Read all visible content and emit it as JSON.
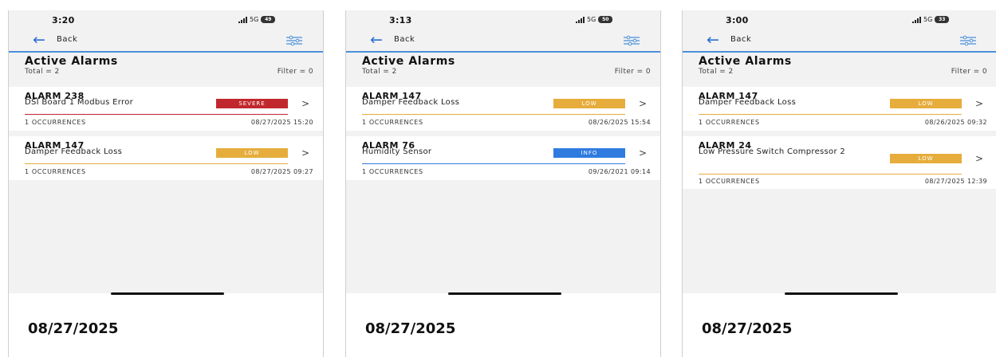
{
  "common": {
    "back_label": "Back",
    "title": "Active Alarms",
    "total": "Total = 2",
    "filter": "Filter = 0",
    "caption": "08/27/2025"
  },
  "colors": {
    "severe": "#c0282d",
    "low": "#e6ad3c",
    "info": "#2f7be0",
    "accent": "#4a8fdb"
  },
  "icons": {
    "back": "left-arrow-icon",
    "filter": "sliders-icon",
    "chevron": "chevron-right-icon"
  },
  "panels": [
    {
      "time": "3:20",
      "network": "5G",
      "battery": "49",
      "alarms": [
        {
          "id": "ALARM 238",
          "desc": "DSI Board 1 Modbus Error",
          "severity": "SEVERE",
          "occurrences": "1 OCCURRENCES",
          "date": "08/27/2025 15:20"
        },
        {
          "id": "ALARM 147",
          "desc": "Damper Feedback Loss",
          "severity": "LOW",
          "occurrences": "1 OCCURRENCES",
          "date": "08/27/2025 09:27"
        }
      ]
    },
    {
      "time": "3:13",
      "network": "5G",
      "battery": "50",
      "alarms": [
        {
          "id": "ALARM 147",
          "desc": "Damper Feedback Loss",
          "severity": "LOW",
          "occurrences": "1 OCCURRENCES",
          "date": "08/26/2025 15:54"
        },
        {
          "id": "ALARM 76",
          "desc": "Humidity Sensor",
          "severity": "INFO",
          "occurrences": "1 OCCURRENCES",
          "date": "09/26/2021 09:14"
        }
      ]
    },
    {
      "time": "3:00",
      "network": "5G",
      "battery": "33",
      "alarms": [
        {
          "id": "ALARM 147",
          "desc": "Damper Feedback Loss",
          "severity": "LOW",
          "occurrences": "1 OCCURRENCES",
          "date": "08/26/2025 09:32"
        },
        {
          "id": "ALARM 24",
          "desc": "Low Pressure Switch Compressor 2",
          "severity": "LOW",
          "occurrences": "1 OCCURRENCES",
          "date": "08/27/2025 12:39"
        }
      ]
    }
  ]
}
